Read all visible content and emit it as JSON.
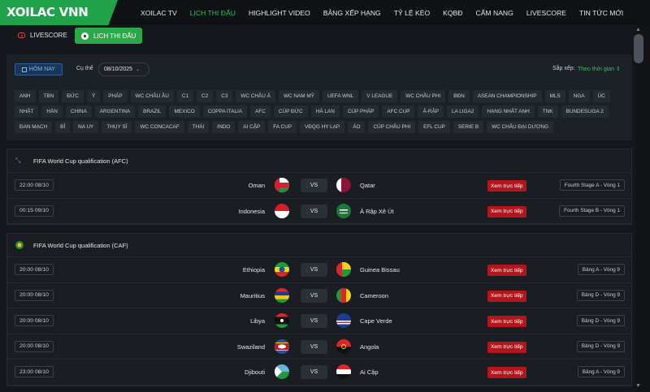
{
  "logo": "XOILAC VNN",
  "nav": [
    "XOILAC TV",
    "LỊCH THI ĐẤU",
    "HIGHLIGHT VIDEO",
    "BẢNG XẾP HẠNG",
    "TỶ LỆ KÈO",
    "KQBĐ",
    "CẨM NANG",
    "LIVESCORE",
    "TIN TỨC MỚI"
  ],
  "nav_active": 1,
  "subbar": {
    "livescore": "LIVESCORE",
    "schedule": "LỊCH THI ĐẤU"
  },
  "filter": {
    "today": "HÔM NAY",
    "specific_label": "Cụ thể",
    "date": "08/10/2025",
    "sort_label": "Sắp xếp:",
    "sort_value": "Theo thời gian",
    "tags": [
      "ANH",
      "TBN",
      "ĐỨC",
      "Ý",
      "PHÁP",
      "WC CHÂU ÂU",
      "C1",
      "C2",
      "C3",
      "WC CHÂU Á",
      "WC NAM MỸ",
      "UEFA WNL",
      "V LEAGUE",
      "WC CHÂU PHI",
      "BĐN",
      "ASEAN CHAMPIONSHIP",
      "MLS",
      "NGA",
      "ÚC",
      "NHẬT",
      "HÀN",
      "CHINA",
      "ARGENTINA",
      "BRAZIL",
      "MEXICO",
      "COPPA ITALIA",
      "AFC",
      "CÚP ĐỨC",
      "HÀ LAN",
      "CÚP PHÁP",
      "AFC CUP",
      "Ả-RẬP",
      "LA LIGA2",
      "HẠNG NHẤT ANH",
      "TNK",
      "BUNDESLIGA 2",
      "ĐAN MẠCH",
      "BỈ",
      "NA UY",
      "THỤY SĨ",
      "WC CONCACAF",
      "THÁI",
      "INDO",
      "AI CẬP",
      "FA CUP",
      "VĐQG HY LẠP",
      "ÁO",
      "CÚP CHÂU PHI",
      "EFL CUP",
      "SERIE B",
      "WC CHÂU ĐẠI DƯƠNG"
    ]
  },
  "watch_label": "Xem trực tiếp",
  "vs_label": "VS",
  "leagues": [
    {
      "name": "FIFA World Cup qualification (AFC)",
      "matches": [
        {
          "time": "22:00 08/10",
          "home": "Oman",
          "away": "Qatar",
          "round": "Fourth Stage A - Vòng 1",
          "home_flag": "oman",
          "away_flag": "qatar"
        },
        {
          "time": "00:15 09/10",
          "home": "Indonesia",
          "away": "Ả Rập Xê Út",
          "round": "Fourth Stage B - Vòng 1",
          "home_flag": "indonesia",
          "away_flag": "saudi"
        }
      ]
    },
    {
      "name": "FIFA World Cup qualification (CAF)",
      "matches": [
        {
          "time": "20:00 08/10",
          "home": "Ethiopia",
          "away": "Guinea Bissau",
          "round": "Bảng A - Vòng 9",
          "home_flag": "ethiopia",
          "away_flag": "guineabissau"
        },
        {
          "time": "20:00 08/10",
          "home": "Mauritius",
          "away": "Cameroon",
          "round": "Bảng D - Vòng 9",
          "home_flag": "mauritius",
          "away_flag": "cameroon"
        },
        {
          "time": "20:00 08/10",
          "home": "Libya",
          "away": "Cape Verde",
          "round": "Bảng D - Vòng 9",
          "home_flag": "libya",
          "away_flag": "capeverde"
        },
        {
          "time": "20:00 08/10",
          "home": "Swaziland",
          "away": "Angola",
          "round": "Bảng D - Vòng 9",
          "home_flag": "swaziland",
          "away_flag": "angola"
        },
        {
          "time": "23:00 08/10",
          "home": "Djibouti",
          "away": "Ai Cập",
          "round": "Bảng A - Vòng 9",
          "home_flag": "djibouti",
          "away_flag": "egypt"
        }
      ]
    }
  ]
}
